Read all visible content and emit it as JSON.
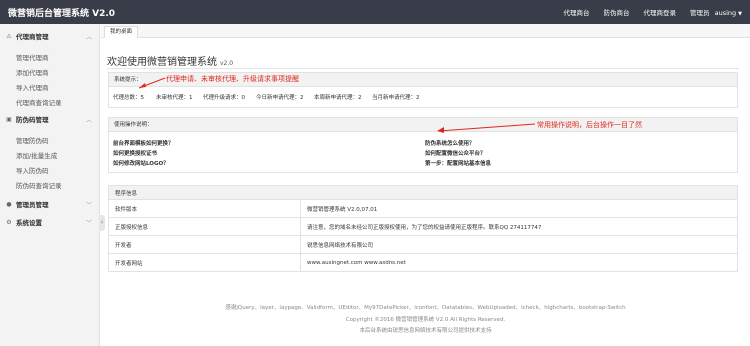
{
  "header": {
    "title": "微营销后台管理系统 V2.0",
    "nav": [
      "代理商台",
      "防伪商台",
      "代理商登录"
    ],
    "user_label": "管理员",
    "username": "ausing"
  },
  "sidebar": {
    "groups": [
      {
        "label": "代理商管理",
        "items": [
          "管理代理商",
          "添加代理商",
          "导入代理商",
          "代理商查询记录"
        ]
      },
      {
        "label": "防伪码管理",
        "items": [
          "管理防伪码",
          "添加/批量生成",
          "导入防伪码",
          "防伪码查询记录"
        ]
      },
      {
        "label": "管理员管理",
        "items": []
      },
      {
        "label": "系统设置",
        "items": []
      }
    ]
  },
  "tab": "我的桌面",
  "welcome": {
    "title": "欢迎使用微营销管理系统",
    "version": "v2.0"
  },
  "sys_hint": {
    "label": "系统提示：",
    "annotation": "代理申请、未审核代理、升级请求事项提醒",
    "stats": [
      "代理总数：5",
      "未审核代理：1",
      "代理升级请求：0",
      "今日新申请代理：2",
      "本周新申请代理：2",
      "当月新申请代理：2"
    ]
  },
  "help": {
    "title": "使用操作说明：",
    "annotation": "常用操作说明，后台操作一目了然",
    "left": [
      "前台界面模板如何更换？",
      "如何更换授权证书",
      "如何修改网站LOGO？"
    ],
    "right": [
      "防伪系统怎么使用？",
      "如何配置微信公众平台？",
      "第一步：配置网站基本信息"
    ]
  },
  "program_info": {
    "title": "程序信息",
    "rows": [
      {
        "k": "软件版本",
        "v": "微营销管理系统 V2.0,07,01"
      },
      {
        "k": "正版授权信息",
        "v": "请注意，您的域名未经公司正版授权使用，为了您的权益请使用正版程序。联系QQ 274117747"
      },
      {
        "k": "开发者",
        "v": "锐思信息网络技术有限公司"
      },
      {
        "k": "开发者网站",
        "v": "www.ausingnet.com  www.asdns.net"
      }
    ]
  },
  "footer": {
    "credits": "感谢jQuery、layer、laypage、Validform、UEditor、My97DatePicker、iconfont、Datatables、WebUploaded、icheck、highcharts、bootstrap-Switch",
    "copyright": "Copyright ©2016 微营销管理系统 V2.0 All Rights Reserved.",
    "support": "本后台系统由锐思信息网络技术有限公司提供技术支持"
  },
  "colors": {
    "topbar": "#393d49",
    "annotation_red": "#e0281e"
  }
}
